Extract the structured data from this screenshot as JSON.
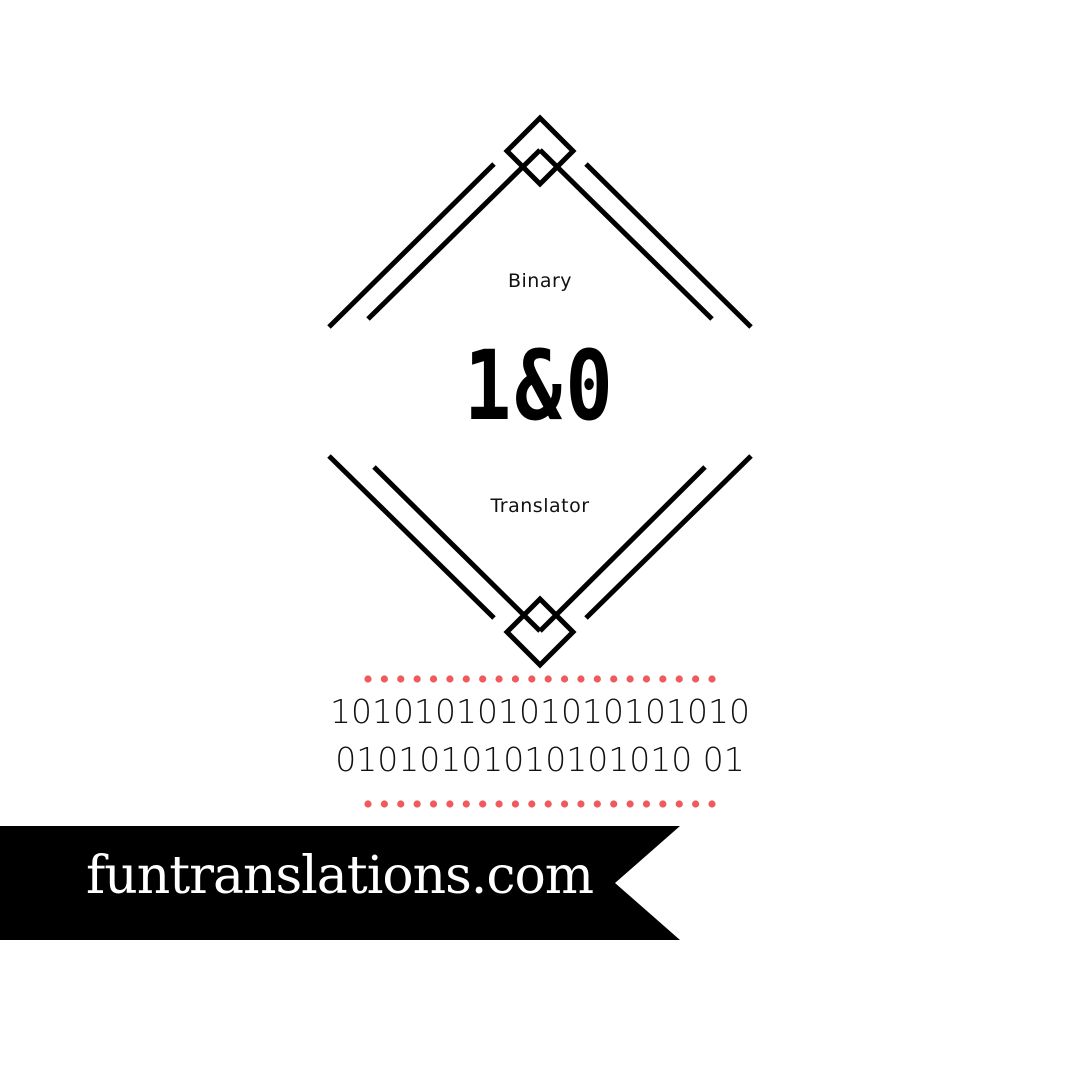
{
  "emblem": {
    "top_label": "Binary",
    "main_label": "1&0",
    "bottom_label": "Translator"
  },
  "binary": {
    "line1": "10101010101010101010",
    "line2": "01010101010101010 01"
  },
  "banner": {
    "text": "funtranslations.com"
  },
  "colors": {
    "line": "#000000",
    "dot": "#f05a5f",
    "banner_bg": "#000000",
    "banner_text": "#ffffff"
  }
}
